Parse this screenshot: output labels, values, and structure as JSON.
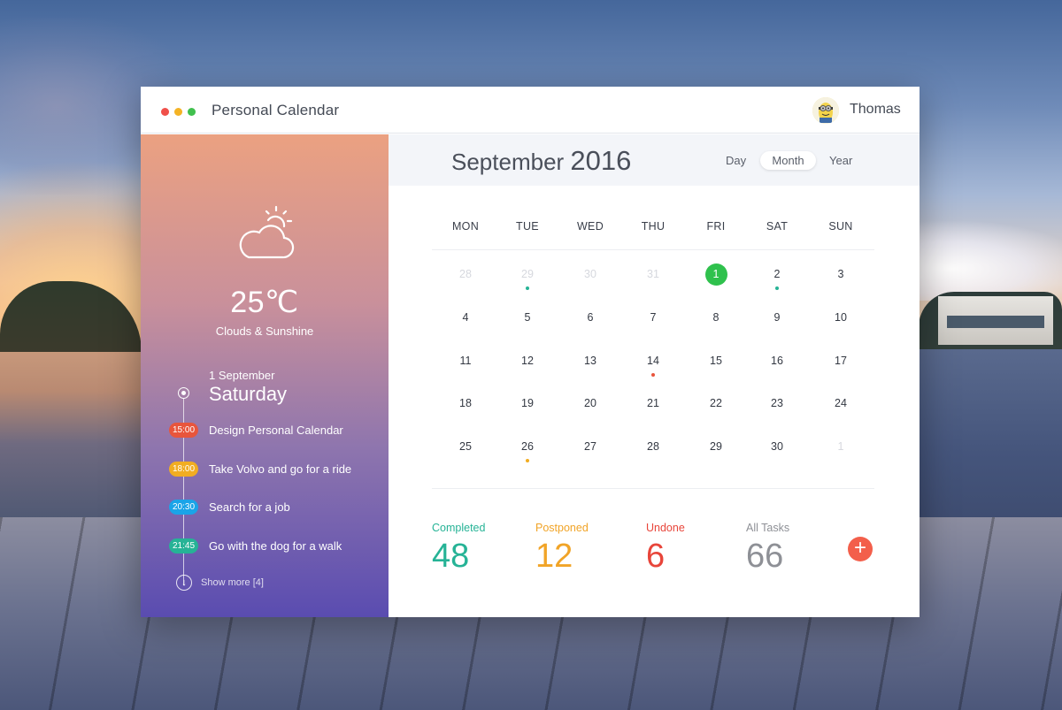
{
  "app": {
    "title": "Personal Calendar"
  },
  "user": {
    "name": "Thomas"
  },
  "weather": {
    "temperature": "25℃",
    "description": "Clouds & Sunshine",
    "icon": "cloud-sun-icon"
  },
  "agenda": {
    "date": "1 September",
    "weekday": "Saturday",
    "events": [
      {
        "time": "15:00",
        "title": "Design Personal Calendar",
        "color": "#e8553c"
      },
      {
        "time": "18:00",
        "title": "Take Volvo and go for a ride",
        "color": "#f1ad22"
      },
      {
        "time": "20:30",
        "title": "Search for a job",
        "color": "#1aa4e8"
      },
      {
        "time": "21:45",
        "title": "Go with the dog for a walk",
        "color": "#26b396"
      }
    ],
    "show_more": "Show more [4]"
  },
  "calendar": {
    "month": "September",
    "year": "2016",
    "views": [
      "Day",
      "Month",
      "Year"
    ],
    "active_view": "Month",
    "weekdays": [
      "MON",
      "TUE",
      "WED",
      "THU",
      "FRI",
      "SAT",
      "SUN"
    ],
    "weeks": [
      [
        "28",
        "29",
        "30",
        "31",
        "1",
        "2",
        "3"
      ],
      [
        "4",
        "5",
        "6",
        "7",
        "8",
        "9",
        "10"
      ],
      [
        "11",
        "12",
        "13",
        "14",
        "15",
        "16",
        "17"
      ],
      [
        "18",
        "19",
        "20",
        "21",
        "22",
        "23",
        "24"
      ],
      [
        "25",
        "26",
        "27",
        "28",
        "29",
        "30",
        "1"
      ]
    ],
    "muted_cells": [
      [
        0,
        0
      ],
      [
        0,
        1
      ],
      [
        0,
        2
      ],
      [
        0,
        3
      ],
      [
        4,
        6
      ]
    ],
    "today_cell": [
      0,
      4
    ],
    "event_markers": [
      {
        "cell": [
          0,
          1
        ],
        "color": "#26b396"
      },
      {
        "cell": [
          0,
          5
        ],
        "color": "#26b396"
      },
      {
        "cell": [
          2,
          3
        ],
        "color": "#e8553c"
      },
      {
        "cell": [
          4,
          1
        ],
        "color": "#f1ad22"
      }
    ],
    "today_color": "#2fc14d"
  },
  "stats": [
    {
      "label": "Completed",
      "value": "48",
      "color": "#26b396"
    },
    {
      "label": "Postponed",
      "value": "12",
      "color": "#f1a427"
    },
    {
      "label": "Undone",
      "value": "6",
      "color": "#e8453a"
    },
    {
      "label": "All Tasks",
      "value": "66",
      "color": "#8e9096"
    }
  ],
  "add_button": {
    "label": "+",
    "color": "#f35f4b"
  }
}
